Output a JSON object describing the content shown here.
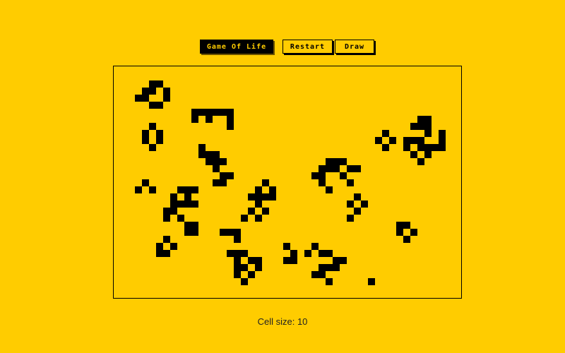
{
  "toolbar": {
    "title_label": "Game Of Life",
    "restart_label": "Restart",
    "draw_label": "Draw"
  },
  "status": {
    "cell_size_label": "Cell size:",
    "cell_size": "10"
  },
  "colors": {
    "background": "#ffcc00",
    "cell": "#000000"
  },
  "board": {
    "cols": 49,
    "rows": 33,
    "live_cells": [
      [
        5,
        2
      ],
      [
        6,
        2
      ],
      [
        4,
        3
      ],
      [
        5,
        3
      ],
      [
        7,
        3
      ],
      [
        3,
        4
      ],
      [
        4,
        4
      ],
      [
        7,
        4
      ],
      [
        5,
        5
      ],
      [
        6,
        5
      ],
      [
        5,
        8
      ],
      [
        4,
        9
      ],
      [
        6,
        9
      ],
      [
        4,
        10
      ],
      [
        6,
        10
      ],
      [
        5,
        11
      ],
      [
        11,
        6
      ],
      [
        12,
        6
      ],
      [
        13,
        6
      ],
      [
        14,
        6
      ],
      [
        15,
        6
      ],
      [
        16,
        6
      ],
      [
        11,
        7
      ],
      [
        13,
        7
      ],
      [
        16,
        7
      ],
      [
        16,
        8
      ],
      [
        12,
        11
      ],
      [
        12,
        12
      ],
      [
        13,
        12
      ],
      [
        14,
        12
      ],
      [
        13,
        13
      ],
      [
        14,
        13
      ],
      [
        15,
        13
      ],
      [
        14,
        14
      ],
      [
        15,
        15
      ],
      [
        16,
        15
      ],
      [
        14,
        16
      ],
      [
        15,
        16
      ],
      [
        4,
        16
      ],
      [
        3,
        17
      ],
      [
        5,
        17
      ],
      [
        9,
        17
      ],
      [
        10,
        17
      ],
      [
        11,
        17
      ],
      [
        8,
        18
      ],
      [
        10,
        18
      ],
      [
        8,
        19
      ],
      [
        9,
        19
      ],
      [
        10,
        19
      ],
      [
        11,
        19
      ],
      [
        7,
        20
      ],
      [
        8,
        20
      ],
      [
        7,
        21
      ],
      [
        9,
        21
      ],
      [
        10,
        22
      ],
      [
        11,
        22
      ],
      [
        10,
        23
      ],
      [
        11,
        23
      ],
      [
        7,
        24
      ],
      [
        6,
        25
      ],
      [
        8,
        25
      ],
      [
        6,
        26
      ],
      [
        7,
        26
      ],
      [
        21,
        16
      ],
      [
        20,
        17
      ],
      [
        22,
        17
      ],
      [
        19,
        18
      ],
      [
        20,
        18
      ],
      [
        21,
        18
      ],
      [
        22,
        18
      ],
      [
        20,
        19
      ],
      [
        19,
        20
      ],
      [
        21,
        20
      ],
      [
        18,
        21
      ],
      [
        20,
        21
      ],
      [
        15,
        23
      ],
      [
        16,
        23
      ],
      [
        17,
        23
      ],
      [
        17,
        24
      ],
      [
        16,
        26
      ],
      [
        17,
        26
      ],
      [
        18,
        26
      ],
      [
        17,
        27
      ],
      [
        19,
        27
      ],
      [
        20,
        27
      ],
      [
        17,
        28
      ],
      [
        18,
        28
      ],
      [
        20,
        28
      ],
      [
        17,
        29
      ],
      [
        19,
        29
      ],
      [
        18,
        30
      ],
      [
        30,
        13
      ],
      [
        31,
        13
      ],
      [
        32,
        13
      ],
      [
        29,
        14
      ],
      [
        30,
        14
      ],
      [
        31,
        14
      ],
      [
        33,
        14
      ],
      [
        34,
        14
      ],
      [
        28,
        15
      ],
      [
        29,
        15
      ],
      [
        32,
        15
      ],
      [
        29,
        16
      ],
      [
        33,
        16
      ],
      [
        30,
        17
      ],
      [
        34,
        18
      ],
      [
        33,
        19
      ],
      [
        35,
        19
      ],
      [
        34,
        20
      ],
      [
        33,
        21
      ],
      [
        38,
        9
      ],
      [
        37,
        10
      ],
      [
        39,
        10
      ],
      [
        38,
        11
      ],
      [
        43,
        7
      ],
      [
        44,
        7
      ],
      [
        42,
        8
      ],
      [
        43,
        8
      ],
      [
        44,
        8
      ],
      [
        44,
        9
      ],
      [
        46,
        9
      ],
      [
        41,
        10
      ],
      [
        42,
        10
      ],
      [
        43,
        10
      ],
      [
        46,
        10
      ],
      [
        41,
        11
      ],
      [
        43,
        11
      ],
      [
        44,
        11
      ],
      [
        45,
        11
      ],
      [
        46,
        11
      ],
      [
        42,
        12
      ],
      [
        44,
        12
      ],
      [
        43,
        13
      ],
      [
        40,
        22
      ],
      [
        41,
        22
      ],
      [
        40,
        23
      ],
      [
        42,
        23
      ],
      [
        41,
        24
      ],
      [
        24,
        25
      ],
      [
        25,
        26
      ],
      [
        24,
        27
      ],
      [
        25,
        27
      ],
      [
        28,
        25
      ],
      [
        27,
        26
      ],
      [
        29,
        26
      ],
      [
        30,
        26
      ],
      [
        31,
        27
      ],
      [
        32,
        27
      ],
      [
        29,
        28
      ],
      [
        30,
        28
      ],
      [
        31,
        28
      ],
      [
        28,
        29
      ],
      [
        29,
        29
      ],
      [
        30,
        30
      ],
      [
        36,
        30
      ]
    ]
  }
}
